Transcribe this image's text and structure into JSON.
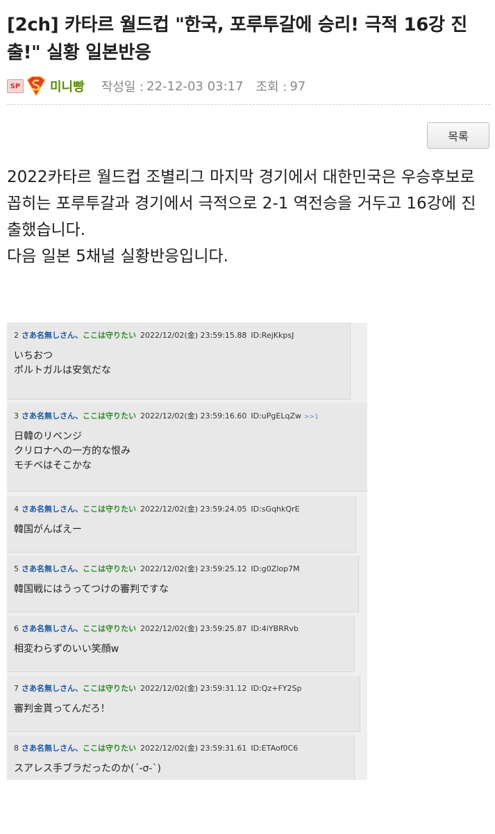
{
  "article": {
    "title": "[2ch] 카타르 월드컵 \"한국, 포루투갈에 승리! 극적 16강 진출!\" 실황 일본반응",
    "level_badge": "SP",
    "author": "미니빵",
    "date_label": "작성일 :",
    "date_value": "22-12-03 03:17",
    "views_label": "조회 :",
    "views_value": "97",
    "list_button": "목록",
    "body_lines": [
      "2022카타르 월드컵 조별리그 마지막 경기에서 대한민국은 우승후보로 꼽히는 포루투갈과 경기에서 극적으로 2-1 역전승을 거두고 16강에 진출했습니다.",
      "다음 일본 5채널 실황반응입니다."
    ]
  },
  "thread": {
    "name_blue": "さあ名無しさん、",
    "name_green": "ここは守りたい",
    "posts": [
      {
        "num": "2",
        "date": "2022/12/02(金) 23:59:15.88",
        "id": "ID:RejKkpsJ",
        "ref": "",
        "lines": [
          "いちおつ",
          "ポルトガルは安気だな"
        ]
      },
      {
        "num": "3",
        "date": "2022/12/02(金) 23:59:16.60",
        "id": "ID:uPgELqZw",
        "ref": ">>1",
        "lines": [
          "日韓のリベンジ",
          "クリロナへの一方的な恨み",
          "モチベはそこかな"
        ]
      },
      {
        "num": "4",
        "date": "2022/12/02(金) 23:59:24.05",
        "id": "ID:sGqhkQrE",
        "ref": "",
        "lines": [
          "韓国がんばえー"
        ]
      },
      {
        "num": "5",
        "date": "2022/12/02(金) 23:59:25.12",
        "id": "ID:g0Zlop7M",
        "ref": "",
        "lines": [
          "韓国戦にはうってつけの審判ですな"
        ]
      },
      {
        "num": "6",
        "date": "2022/12/02(金) 23:59:25.87",
        "id": "ID:4iYBRRvb",
        "ref": "",
        "lines": [
          "相変わらずのいい笑顔w"
        ]
      },
      {
        "num": "7",
        "date": "2022/12/02(金) 23:59:31.12",
        "id": "ID:Qz+FY2Sp",
        "ref": "",
        "lines": [
          "審判金貰ってんだろ！"
        ]
      },
      {
        "num": "8",
        "date": "2022/12/02(金) 23:59:31.61",
        "id": "ID:ETAof0C6",
        "ref": "",
        "lines": [
          "スアレス手ブラだったのか(´-σ-`)"
        ]
      }
    ]
  },
  "colors": {
    "author": "#5a8a00",
    "name_blue": "#1a56a6",
    "name_green": "#2e8b2e",
    "meta_gray": "#888888"
  }
}
